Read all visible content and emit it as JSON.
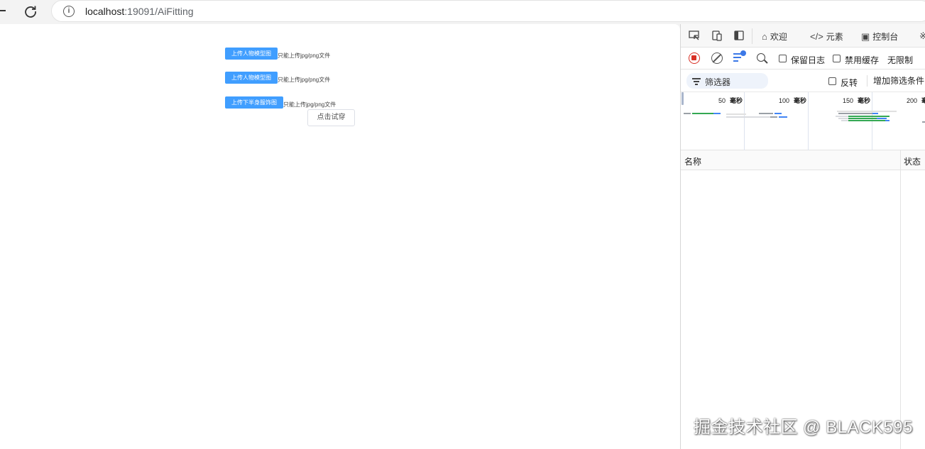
{
  "browser": {
    "url_host": "localhost",
    "url_path": ":19091/AiFitting"
  },
  "page": {
    "uploads": [
      {
        "button": "上传人物模型图",
        "hint": "只能上传jpg/png文件"
      },
      {
        "button": "上传人物模型图",
        "hint": "只能上传jpg/png文件"
      },
      {
        "button": "上传下半身服饰图",
        "hint": "只能上传jpg/png文件"
      }
    ],
    "try_on_button": "点击试穿"
  },
  "devtools": {
    "tabs": [
      {
        "label": "欢迎",
        "icon": "home-icon"
      },
      {
        "label": "元素",
        "icon": "code-icon"
      },
      {
        "label": "控制台",
        "icon": "console-icon"
      }
    ],
    "toolbar": {
      "preserve_log": "保留日志",
      "disable_cache": "禁用缓存",
      "throttling": "无限制"
    },
    "filterbar": {
      "filter": "筛选器",
      "invert": "反转",
      "more_filters": "增加筛选条件"
    },
    "timeline": {
      "ticks": [
        {
          "value": "50",
          "unit": "毫秒"
        },
        {
          "value": "100",
          "unit": "毫秒"
        },
        {
          "value": "150",
          "unit": "毫秒"
        },
        {
          "value": "200",
          "unit": "毫秒"
        }
      ]
    },
    "table": {
      "columns": [
        "名称",
        "状态"
      ]
    }
  },
  "watermark": "掘金技术社区 @ BLACK595",
  "colors": {
    "primary_button": "#409eff",
    "record": "#d93025",
    "accent": "#3b78e7"
  }
}
